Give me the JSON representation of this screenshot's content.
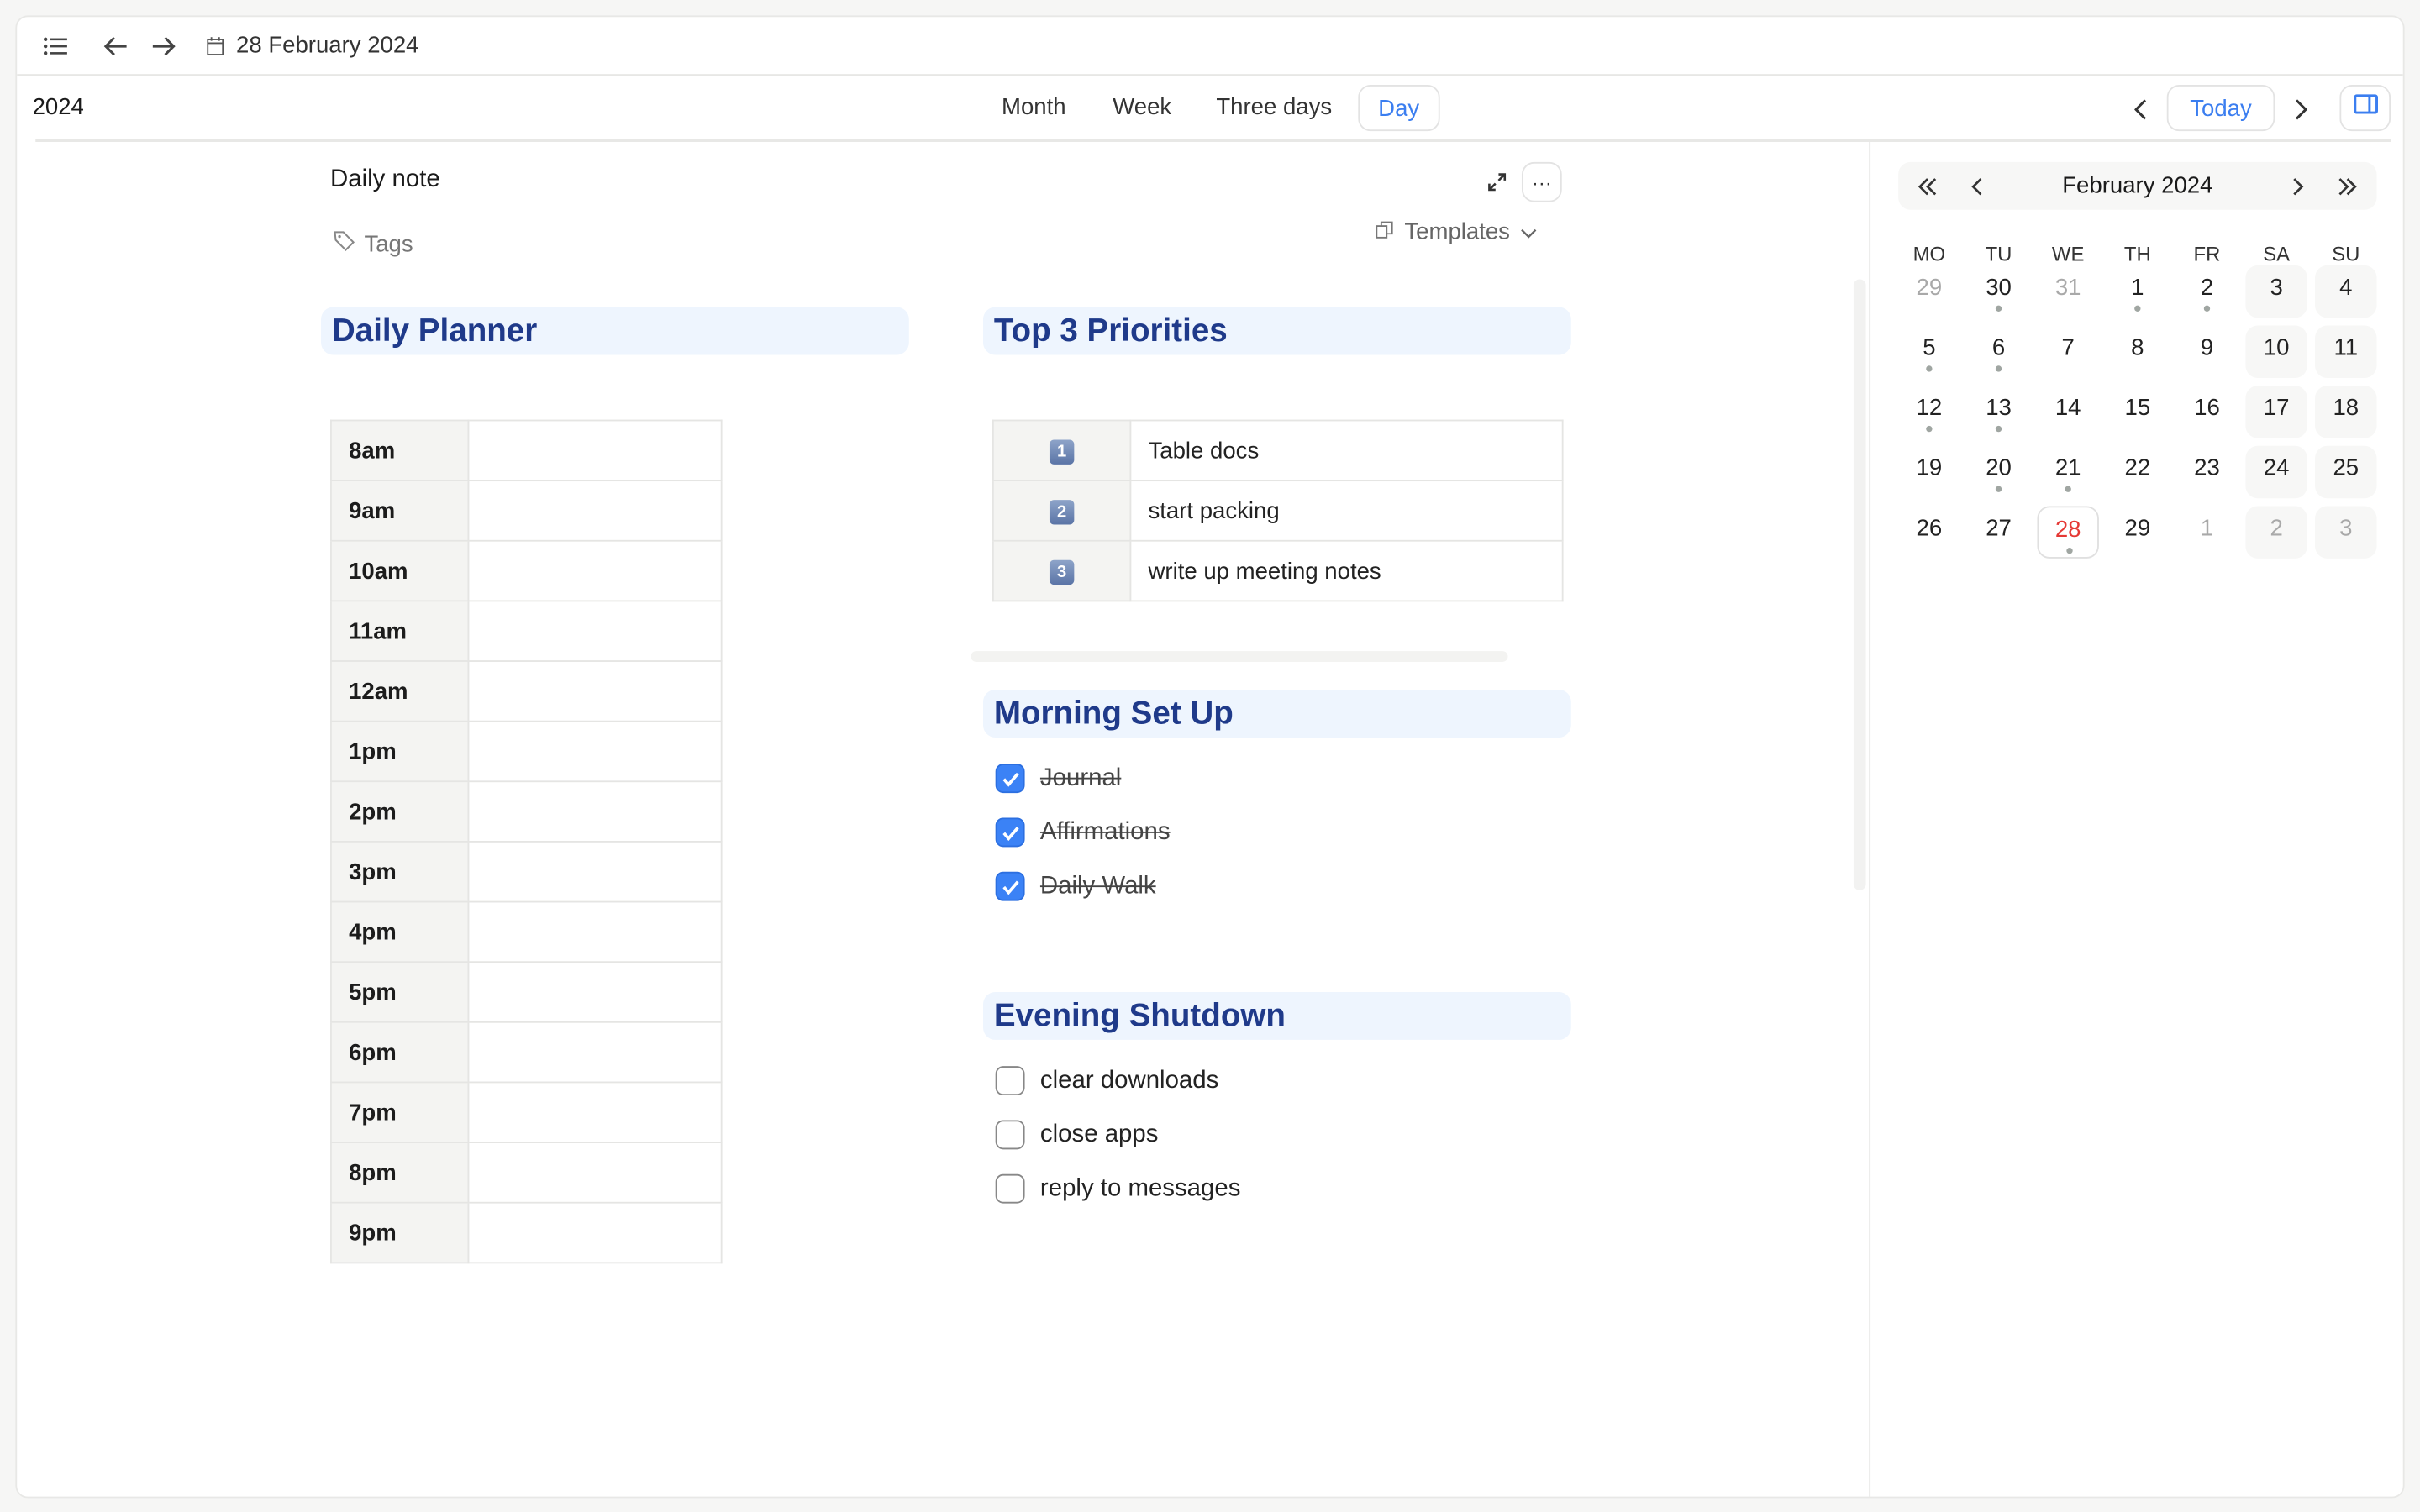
{
  "header": {
    "date": "28 February 2024"
  },
  "toolbar": {
    "year": "2024",
    "views": [
      "Month",
      "Week",
      "Three days",
      "Day"
    ],
    "active_view": "Day",
    "today": "Today"
  },
  "note": {
    "title": "Daily note",
    "tags": "Tags",
    "templates": "Templates"
  },
  "planner": {
    "heading": "Daily Planner",
    "hours": [
      "8am",
      "9am",
      "10am",
      "11am",
      "12am",
      "1pm",
      "2pm",
      "3pm",
      "4pm",
      "5pm",
      "6pm",
      "7pm",
      "8pm",
      "9pm"
    ]
  },
  "priorities": {
    "heading": "Top 3 Priorities",
    "items": [
      {
        "num": "1",
        "text": "Table docs"
      },
      {
        "num": "2",
        "text": "start packing"
      },
      {
        "num": "3",
        "text": "write up meeting notes"
      }
    ]
  },
  "morning": {
    "heading": "Morning Set Up",
    "items": [
      {
        "text": "Journal",
        "checked": true
      },
      {
        "text": "Affirmations",
        "checked": true
      },
      {
        "text": "Daily Walk",
        "checked": true
      }
    ]
  },
  "evening": {
    "heading": "Evening Shutdown",
    "items": [
      {
        "text": "clear downloads",
        "checked": false
      },
      {
        "text": "close apps",
        "checked": false
      },
      {
        "text": "reply to messages",
        "checked": false
      }
    ]
  },
  "calendar": {
    "title": "February 2024",
    "dow": [
      "MO",
      "TU",
      "WE",
      "TH",
      "FR",
      "SA",
      "SU"
    ],
    "weeks": [
      [
        {
          "d": "29",
          "m": 1,
          "dot": 0
        },
        {
          "d": "30",
          "m": 0,
          "dot": 1
        },
        {
          "d": "31",
          "m": 1,
          "dot": 0
        },
        {
          "d": "1",
          "m": 0,
          "dot": 1
        },
        {
          "d": "2",
          "m": 0,
          "dot": 1
        },
        {
          "d": "3",
          "m": 0,
          "dot": 0
        },
        {
          "d": "4",
          "m": 0,
          "dot": 0
        }
      ],
      [
        {
          "d": "5",
          "m": 0,
          "dot": 1
        },
        {
          "d": "6",
          "m": 0,
          "dot": 1
        },
        {
          "d": "7",
          "m": 0,
          "dot": 0
        },
        {
          "d": "8",
          "m": 0,
          "dot": 0
        },
        {
          "d": "9",
          "m": 0,
          "dot": 0
        },
        {
          "d": "10",
          "m": 0,
          "dot": 0
        },
        {
          "d": "11",
          "m": 0,
          "dot": 0
        }
      ],
      [
        {
          "d": "12",
          "m": 0,
          "dot": 1
        },
        {
          "d": "13",
          "m": 0,
          "dot": 1
        },
        {
          "d": "14",
          "m": 0,
          "dot": 0
        },
        {
          "d": "15",
          "m": 0,
          "dot": 0
        },
        {
          "d": "16",
          "m": 0,
          "dot": 0
        },
        {
          "d": "17",
          "m": 0,
          "dot": 0
        },
        {
          "d": "18",
          "m": 0,
          "dot": 0
        }
      ],
      [
        {
          "d": "19",
          "m": 0,
          "dot": 0
        },
        {
          "d": "20",
          "m": 0,
          "dot": 1
        },
        {
          "d": "21",
          "m": 0,
          "dot": 1
        },
        {
          "d": "22",
          "m": 0,
          "dot": 0
        },
        {
          "d": "23",
          "m": 0,
          "dot": 0
        },
        {
          "d": "24",
          "m": 0,
          "dot": 0
        },
        {
          "d": "25",
          "m": 0,
          "dot": 0
        }
      ],
      [
        {
          "d": "26",
          "m": 0,
          "dot": 0
        },
        {
          "d": "27",
          "m": 0,
          "dot": 0
        },
        {
          "d": "28",
          "m": 0,
          "dot": 1,
          "today": 1
        },
        {
          "d": "29",
          "m": 0,
          "dot": 0
        },
        {
          "d": "1",
          "m": 1,
          "dot": 0
        },
        {
          "d": "2",
          "m": 1,
          "dot": 0
        },
        {
          "d": "3",
          "m": 1,
          "dot": 0
        }
      ]
    ]
  },
  "colors": {
    "accent": "#3b7ef0",
    "heading": "#1f3a8a",
    "heading_bg": "#eef5fe",
    "today": "#e53935"
  }
}
